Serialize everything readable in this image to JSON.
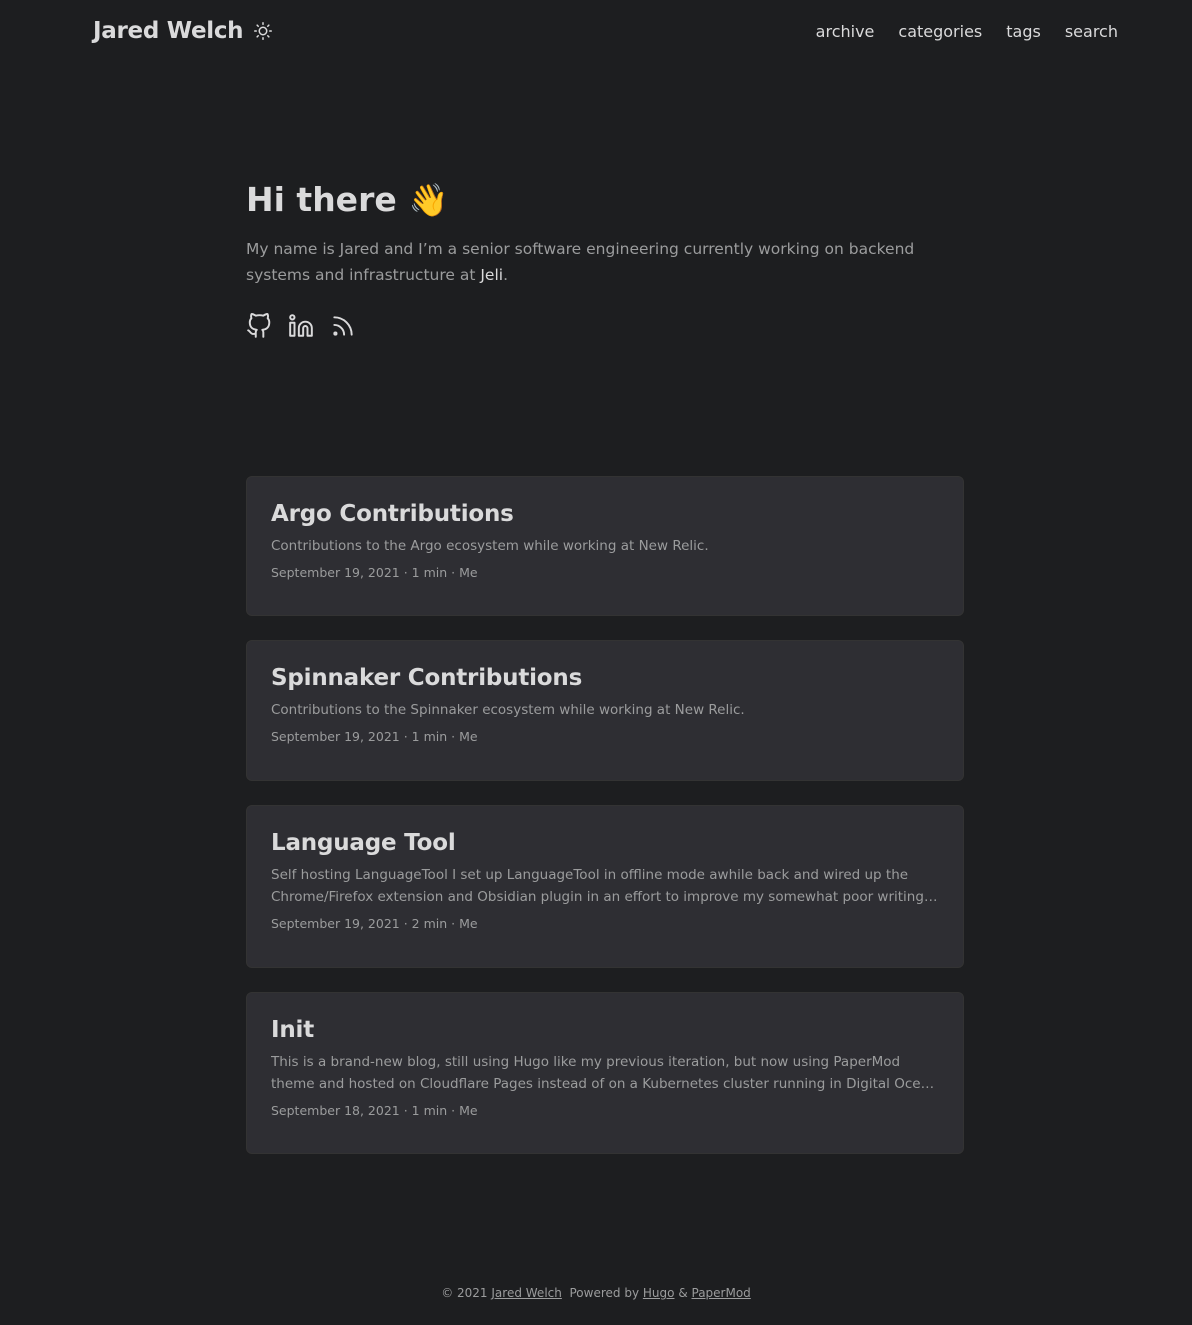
{
  "site": {
    "title": "Jared Welch"
  },
  "nav": {
    "archive": "archive",
    "categories": "categories",
    "tags": "tags",
    "search": "search"
  },
  "hero": {
    "title": "Hi there",
    "emoji": "👋",
    "text_before": "My name is Jared and I’m a senior software engineering currently working on backend systems and infrastructure at ",
    "link_text": "Jeli",
    "text_after": "."
  },
  "social_icons": [
    "github-icon",
    "linkedin-icon",
    "rss-icon"
  ],
  "posts": [
    {
      "title": "Argo Contributions",
      "summary": "Contributions to the Argo ecosystem while working at New Relic.",
      "meta": "September 19, 2021 · 1 min · Me"
    },
    {
      "title": "Spinnaker Contributions",
      "summary": "Contributions to the Spinnaker ecosystem while working at New Relic.",
      "meta": "September 19, 2021 · 1 min · Me"
    },
    {
      "title": "Language Tool",
      "summary": "Self hosting LanguageTool I set up LanguageTool in offline mode awhile back and wired up the Chrome/Firefox extension and Obsidian plugin in an effort to improve my somewhat poor writing. Writing...",
      "meta": "September 19, 2021 · 2 min · Me"
    },
    {
      "title": "Init",
      "summary": "This is a brand-new blog, still using Hugo like my previous iteration, but now using PaperMod theme and hosted on Cloudflare Pages instead of on a Kubernetes cluster running in Digital Ocean (I know, I know, a...",
      "meta": "September 18, 2021 · 1 min · Me"
    }
  ],
  "footer": {
    "copyright": "© 2021",
    "author_link": "Jared Welch",
    "powered_by": "Powered by",
    "hugo_link": "Hugo",
    "amp": "&",
    "theme_link": "PaperMod"
  },
  "colors": {
    "background": "#1d1e20",
    "card": "#2e2e33",
    "primary_text": "#dadadb",
    "secondary_text": "#9b9c9d"
  }
}
